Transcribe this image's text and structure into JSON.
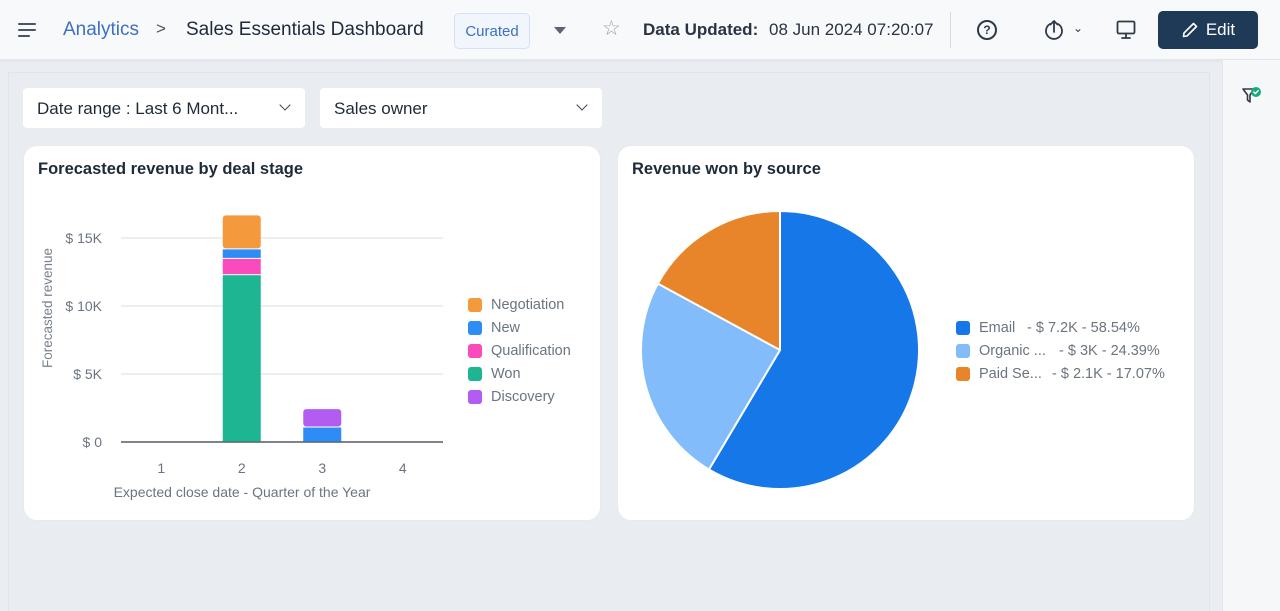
{
  "header": {
    "breadcrumb_root": "Analytics",
    "breadcrumb_sep": ">",
    "title": "Sales Essentials Dashboard",
    "badge": "Curated",
    "data_updated_label": "Data Updated:",
    "data_updated_value": "08 Jun 2024 07:20:07",
    "help_glyph": "?",
    "share_chevron": "⌄",
    "edit_label": "Edit"
  },
  "filters": {
    "date_range": "Date range :  Last 6 Mont...",
    "sales_owner": "Sales owner"
  },
  "colors": {
    "primary_dark": "#1e3a57",
    "link": "#3d6fc4",
    "filter_applied": "#1aaa7a"
  },
  "chart_data": [
    {
      "type": "bar",
      "stacked": true,
      "title": "Forecasted revenue by deal stage",
      "xlabel": "Expected close date - Quarter of the Year",
      "ylabel": "Forecasted revenue",
      "categories": [
        "1",
        "2",
        "3",
        "4"
      ],
      "yticks": [
        0,
        5000,
        10000,
        15000
      ],
      "ytick_labels": [
        "$ 0",
        "$ 5K",
        "$ 10K",
        "$ 15K"
      ],
      "ylim": [
        0,
        18000
      ],
      "grid": true,
      "legend_position": "right",
      "series": [
        {
          "name": "Won",
          "color": "#1db592",
          "values": [
            0,
            12300,
            0,
            0
          ]
        },
        {
          "name": "Qualification",
          "color": "#f94bbd",
          "values": [
            0,
            1200,
            0,
            0
          ]
        },
        {
          "name": "New",
          "color": "#2e8cf5",
          "values": [
            0,
            700,
            1100,
            0
          ]
        },
        {
          "name": "Negotiation",
          "color": "#f59a3c",
          "values": [
            0,
            2500,
            0,
            0
          ]
        },
        {
          "name": "Discovery",
          "color": "#b35cf2",
          "values": [
            0,
            0,
            1350,
            0
          ]
        }
      ],
      "legend_order": [
        "Negotiation",
        "New",
        "Qualification",
        "Won",
        "Discovery"
      ]
    },
    {
      "type": "pie",
      "title": "Revenue won by source",
      "legend_position": "right",
      "slices": [
        {
          "label": "Email",
          "display_label": "Email",
          "value_label": "- $ 7.2K - 58.54%",
          "value": 7200,
          "percent": 58.54,
          "color": "#1677e8"
        },
        {
          "label": "Organic",
          "display_label": "Organic ...",
          "value_label": "- $ 3K - 24.39%",
          "value": 3000,
          "percent": 24.39,
          "color": "#82bcfb"
        },
        {
          "label": "Paid Search",
          "display_label": "Paid Se...",
          "value_label": "- $ 2.1K - 17.07%",
          "value": 2100,
          "percent": 17.07,
          "color": "#e8852a"
        }
      ]
    }
  ]
}
